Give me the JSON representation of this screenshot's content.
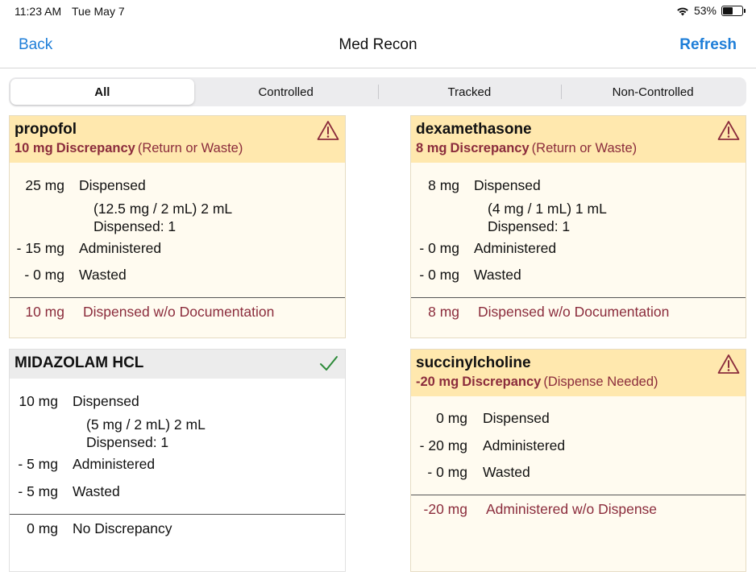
{
  "status_bar": {
    "time": "11:23 AM",
    "date": "Tue May 7",
    "battery": "53%",
    "battery_level": 0.53
  },
  "nav": {
    "back": "Back",
    "title": "Med Recon",
    "refresh": "Refresh"
  },
  "tabs": [
    {
      "label": "All",
      "active": true
    },
    {
      "label": "Controlled",
      "active": false
    },
    {
      "label": "Tracked",
      "active": false
    },
    {
      "label": "Non-Controlled",
      "active": false
    }
  ],
  "cards": {
    "propofol": {
      "name": "propofol",
      "disc_amount": "10 mg",
      "disc_word": "Discrepancy",
      "disc_reason": "(Return or Waste)",
      "dispensed_amt": "25 mg",
      "dispensed_lbl": "Dispensed",
      "conc": "(12.5 mg / 2 mL) 2 mL",
      "count": "Dispensed: 1",
      "admin_amt": "- 15 mg",
      "admin_lbl": "Administered",
      "waste_amt": "- 0 mg",
      "waste_lbl": "Wasted",
      "result_amt": "10 mg",
      "result_lbl": "Dispensed w/o Documentation"
    },
    "dexamethasone": {
      "name": "dexamethasone",
      "disc_amount": "8 mg",
      "disc_word": "Discrepancy",
      "disc_reason": "(Return or Waste)",
      "dispensed_amt": "8 mg",
      "dispensed_lbl": "Dispensed",
      "conc": "(4 mg / 1 mL) 1 mL",
      "count": "Dispensed: 1",
      "admin_amt": "- 0 mg",
      "admin_lbl": "Administered",
      "waste_amt": "- 0 mg",
      "waste_lbl": "Wasted",
      "result_amt": "8 mg",
      "result_lbl": "Dispensed w/o Documentation"
    },
    "midazolam": {
      "name": "MIDAZOLAM HCL",
      "dispensed_amt": "10 mg",
      "dispensed_lbl": "Dispensed",
      "conc": "(5 mg / 2 mL) 2 mL",
      "count": "Dispensed: 1",
      "admin_amt": "- 5 mg",
      "admin_lbl": "Administered",
      "waste_amt": "- 5 mg",
      "waste_lbl": "Wasted",
      "result_amt": "0 mg",
      "result_lbl": "No Discrepancy"
    },
    "succinylcholine": {
      "name": "succinylcholine",
      "disc_amount": "-20 mg",
      "disc_word": "Discrepancy",
      "disc_reason": "(Dispense Needed)",
      "dispensed_amt": "0 mg",
      "dispensed_lbl": "Dispensed",
      "admin_amt": "- 20 mg",
      "admin_lbl": "Administered",
      "waste_amt": "- 0 mg",
      "waste_lbl": "Wasted",
      "result_amt": "-20 mg",
      "result_lbl": "Administered w/o Dispense"
    }
  },
  "icons": {
    "warning": "warning-triangle-icon",
    "ok": "checkmark-icon",
    "wifi": "wifi-icon",
    "battery": "battery-icon"
  },
  "colors": {
    "accent": "#1e7ed8",
    "discrepancy_text": "#8b2c3c",
    "header_warn": "#ffe8ae",
    "card_warn": "#fffbf0",
    "check": "#2e8b3a"
  }
}
